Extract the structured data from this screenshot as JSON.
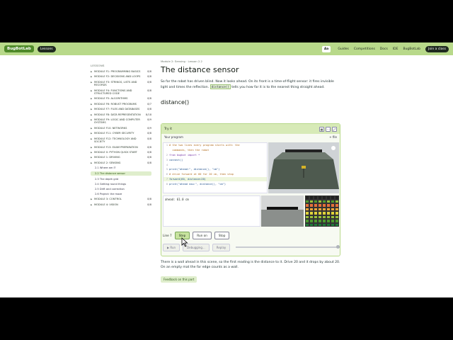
{
  "topbar": {
    "logo": "BugBotLab",
    "lessons": "Lessons",
    "font_toggle": "Aa",
    "links": [
      "Guides",
      "Competitions",
      "Docs",
      "IDE",
      "BugBotLab"
    ],
    "join": "Join a class"
  },
  "sidebar": {
    "heading": "LESSONS",
    "modules": [
      {
        "name": "MODULE F1: PROGRAMMING BASICS",
        "count": "8/8"
      },
      {
        "name": "MODULE F2: DECISIONS AND LOOPS",
        "count": "8/8"
      },
      {
        "name": "MODULE F3: STRINGS, LISTS AND RECORDS",
        "count": "8/8"
      },
      {
        "name": "MODULE F4: FUNCTIONS AND STRUCTURED CODE",
        "count": "8/8"
      },
      {
        "name": "MODULE F5: ALGORITHMS",
        "count": "8/8"
      },
      {
        "name": "MODULE F6: ROBUST PROGRAMS",
        "count": "8/7"
      },
      {
        "name": "MODULE F7: FILES AND DATABASES",
        "count": "8/8"
      },
      {
        "name": "MODULE F8: DATA REPRESENTATION",
        "count": "8/18"
      },
      {
        "name": "MODULE F9: LOGIC AND COMPUTER SYSTEMS",
        "count": "8/9"
      },
      {
        "name": "MODULE F10: NETWORKS",
        "count": "8/9"
      },
      {
        "name": "MODULE F11: CYBER SECURITY",
        "count": "8/8"
      },
      {
        "name": "MODULE F12: TECHNOLOGY AND SOCIETY",
        "count": "8/8"
      },
      {
        "name": "MODULE F13: EXAM PREPARATION",
        "count": "8/8"
      },
      {
        "name": "MODULE 0: PYTHON QUICK START",
        "count": "8/8"
      },
      {
        "name": "MODULE 1: DRIVING",
        "count": "8/8"
      },
      {
        "name": "MODULE 2: SENSING",
        "count": "8/8"
      }
    ],
    "subs": [
      {
        "label": "2.1 Where am I?"
      },
      {
        "label": "2.2 The distance sensor"
      },
      {
        "label": "2.3 The depth grid"
      },
      {
        "label": "2.4 Getting round things"
      },
      {
        "label": "2.5 Drift and correction"
      },
      {
        "label": "2.6 Project: the maze"
      }
    ],
    "after_modules": [
      {
        "name": "MODULE 3: CONTROL",
        "count": "8/8"
      },
      {
        "name": "MODULE 4: VISION",
        "count": "8/8"
      }
    ]
  },
  "main": {
    "crumb": "Module 2: Sensing · Lesson 2.2",
    "title": "The distance sensor",
    "intro_pre": "So far the robot has driven blind. Now it looks ahead. On its front is a time-of-flight sensor: it fires invisible light and times the reflection. ",
    "intro_code": "distance()",
    "intro_post": " tells you how far it is to the nearest thing straight ahead.",
    "h2": "distance()",
    "after": "There is a wall ahead in this scene, so the first reading is the distance to it. Drive 20 and it drops by about 20. On an empty mat the far edge counts as a wall.",
    "feedback": "Feedback on this part"
  },
  "tryit": {
    "title": "Try it",
    "program_label": "Your program",
    "program_right": "+ file",
    "code": [
      {
        "n": "1",
        "t": "# the two lines every program starts with: the",
        "cls": "cmt"
      },
      {
        "n": "",
        "t": "  commands, then the robot",
        "cls": "cmt"
      },
      {
        "n": "2",
        "t": "from bugbot import *",
        "cls": "kw"
      },
      {
        "n": "3",
        "t": "connect()",
        "cls": "fn"
      },
      {
        "n": "4",
        "t": "",
        "cls": ""
      },
      {
        "n": "5",
        "t": "print(\"ahead:\", distance(), \"cm\")",
        "cls": "fn"
      },
      {
        "n": "6",
        "t": "# drive forward at 60 for 20 cm, then stop",
        "cls": "cmt"
      },
      {
        "n": "7",
        "t": "forward(60, distance=20)",
        "cls": "fn"
      },
      {
        "n": "8",
        "t": "print(\"ahead now:\", distance(), \"cm\")",
        "cls": "fn"
      }
    ],
    "output": "ahead: 61.0 cm",
    "line_label": "Line 7",
    "step": "Step",
    "run_on": "Run on",
    "stop": "Stop",
    "run": "▶ Run",
    "debugging": "Debugging...",
    "replay": "Replay"
  },
  "colors": {
    "brand": "#b8d98a",
    "accent": "#4f8a2a"
  }
}
